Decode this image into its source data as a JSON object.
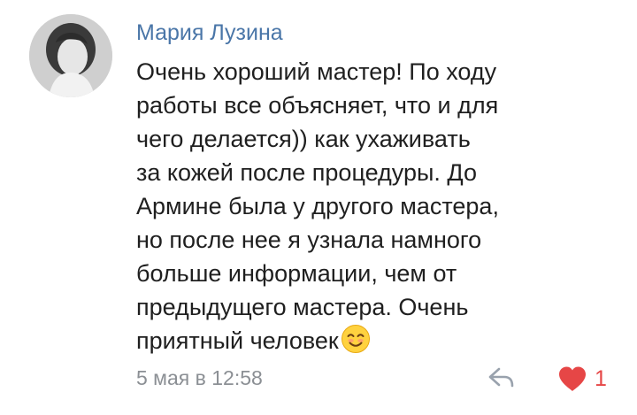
{
  "comment": {
    "author": "Мария Лузина",
    "text_lines": [
      "Очень хороший мастер! По ходу",
      "работы все объясняет, что и для",
      "чего делается)) как ухаживать",
      "за кожей после процедуры. До",
      "Армине была у другого мастера,",
      "но после нее я узнала намного",
      "больше информации, чем от",
      "предыдущего мастера. Очень",
      "приятный человек"
    ],
    "date": "5 мая в 12:58",
    "likes": "1"
  },
  "icons": {
    "avatar": "user-photo",
    "emoji": "smiling-face-icon",
    "reply": "reply-arrow-icon",
    "like": "heart-icon"
  },
  "colors": {
    "author": "#4a76a8",
    "text": "#1f1f1f",
    "meta": "#8b8f94",
    "like": "#e64646"
  }
}
